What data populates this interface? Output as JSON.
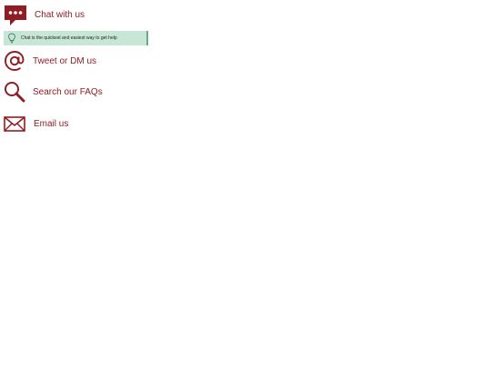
{
  "contact_options": {
    "chat": {
      "label": "Chat with us",
      "icon": "chat-bubble-icon"
    },
    "chat_tip": {
      "text": "Chat is the quickest and easiest way to get help",
      "icon": "lightbulb-icon"
    },
    "tweet": {
      "label": "Tweet or DM us",
      "icon": "at-sign-icon"
    },
    "faq": {
      "label": "Search our FAQs",
      "icon": "magnifier-icon"
    },
    "email": {
      "label": "Email us",
      "icon": "envelope-icon"
    }
  },
  "colors": {
    "accent": "#8e1d24",
    "tip_background": "#c6e6d6",
    "tip_border": "#6fa889"
  }
}
